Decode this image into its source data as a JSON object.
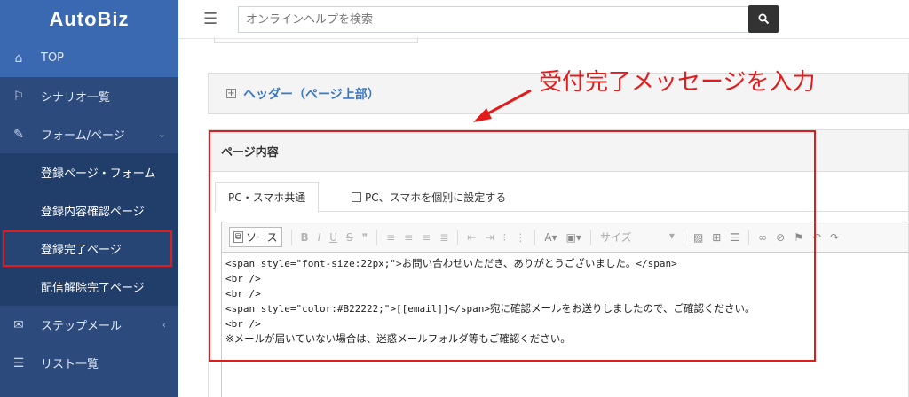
{
  "app": {
    "logo": "AutoBiz"
  },
  "topbar": {
    "search_placeholder": "オンラインヘルプを検索"
  },
  "sidebar": {
    "items": [
      {
        "label": "TOP",
        "icon": "home-icon"
      },
      {
        "label": "シナリオ一覧",
        "icon": "flag-icon"
      },
      {
        "label": "フォーム/ページ",
        "icon": "pen-icon"
      },
      {
        "label": "ステップメール",
        "icon": "envelope-icon"
      },
      {
        "label": "リスト一覧",
        "icon": "list-icon"
      }
    ],
    "subitems": [
      {
        "label": "登録ページ・フォーム"
      },
      {
        "label": "登録内容確認ページ"
      },
      {
        "label": "登録完了ページ"
      },
      {
        "label": "配信解除完了ページ"
      }
    ]
  },
  "header_panel": {
    "title": "ヘッダー（ページ上部）"
  },
  "annotation": {
    "text": "受付完了メッセージを入力"
  },
  "page_panel": {
    "title": "ページ内容",
    "tabs": [
      {
        "label": "PC・スマホ共通"
      },
      {
        "label": "PC、スマホを個別に設定する"
      }
    ]
  },
  "editor": {
    "source_label": "ソース",
    "size_label": "サイズ",
    "lines": [
      {
        "code": "<span style=\"font-size:22px;\">",
        "jp": "お問い合わせいただき、ありがとうございました。",
        "tail": "</span>"
      },
      {
        "code": "<br />",
        "jp": "",
        "tail": ""
      },
      {
        "code": "<br />",
        "jp": "",
        "tail": ""
      },
      {
        "code": "<span style=\"color:#B22222;\">[[email]]</span>",
        "jp": "宛に確認メールをお送りしましたので、ご確認ください。",
        "tail": ""
      },
      {
        "code": "<br />",
        "jp": "",
        "tail": ""
      },
      {
        "code": "",
        "jp": "※メールが届いていない場合は、迷惑メールフォルダ等もご確認ください。",
        "tail": ""
      }
    ]
  },
  "colors": {
    "sidebar": "#2c4a7c",
    "accent": "#3a69b1",
    "highlight": "#e21b1b",
    "link": "#3a78c3"
  }
}
